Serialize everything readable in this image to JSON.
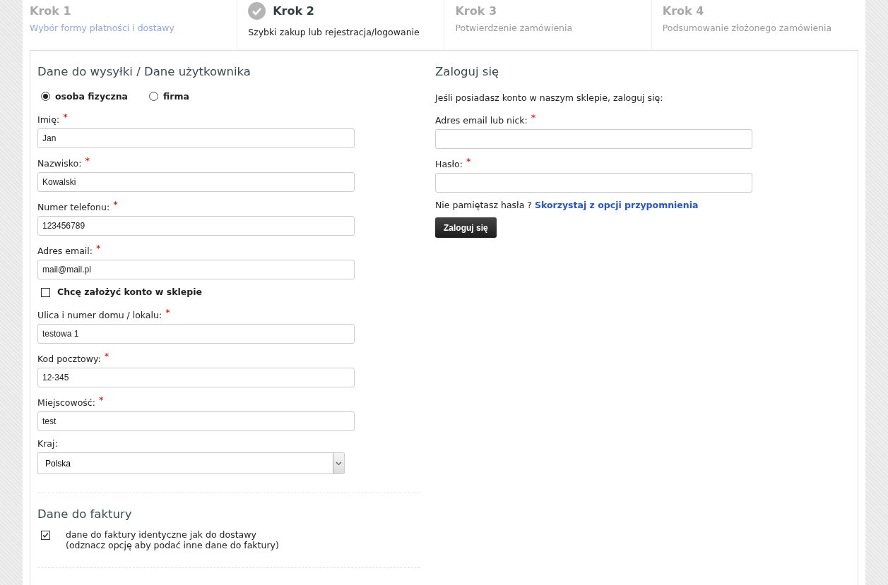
{
  "steps": [
    {
      "title": "Krok 1",
      "subtitle": "Wybór formy płatności i dostawy",
      "done": true,
      "selected": false
    },
    {
      "title": "Krok 2",
      "subtitle": "Szybki zakup lub rejestracja/logowanie",
      "done": false,
      "selected": true
    },
    {
      "title": "Krok 3",
      "subtitle": "Potwierdzenie zamówienia",
      "done": false,
      "selected": false
    },
    {
      "title": "Krok 4",
      "subtitle": "Podsumowanie złożonego zamówienia",
      "done": false,
      "selected": false
    }
  ],
  "shipping": {
    "heading": "Dane do wysyłki / Dane użytkownika",
    "customer_type": [
      {
        "label": "osoba fizyczna",
        "selected": true
      },
      {
        "label": "firma",
        "selected": false
      }
    ],
    "fields": [
      {
        "kind": "text",
        "label": "Imię:",
        "marker": "*",
        "value": "Jan"
      },
      {
        "kind": "text",
        "label": "Nazwisko:",
        "marker": "*",
        "value": "Kowalski"
      },
      {
        "kind": "text",
        "label": "Numer telefonu:",
        "marker": "*",
        "value": "123456789"
      },
      {
        "kind": "text",
        "label": "Adres email:",
        "marker": "*",
        "value": "mail@mail.pl"
      },
      {
        "kind": "checkbox",
        "label": "Chcę założyć konto w sklepie",
        "checked": false
      },
      {
        "kind": "text",
        "label": "Ulica i numer domu / lokalu:",
        "marker": "*",
        "value": "testowa 1"
      },
      {
        "kind": "text",
        "label": "Kod pocztowy:",
        "marker": "*",
        "value": "12-345"
      },
      {
        "kind": "text",
        "label": "Miejscowość:",
        "marker": "*",
        "value": "test"
      },
      {
        "kind": "select",
        "label": "Kraj:",
        "value": "Polska"
      }
    ]
  },
  "invoice": {
    "heading": "Dane do faktury",
    "checked": true,
    "label": "dane do faktury identyczne jak do dostawy",
    "hint": "(odznacz opcję aby podać inne dane do faktury)"
  },
  "login": {
    "heading": "Zaloguj się",
    "intro": "Jeśli posiadasz konto w naszym sklepie, zaloguj się:",
    "fields": [
      {
        "label": "Adres email lub nick:",
        "marker": "*"
      },
      {
        "label": "Hasło:",
        "marker": "*"
      }
    ],
    "forgot": "Nie pamiętasz hasła ?",
    "forgot_link": "Skorzystaj z opcji przypomnienia",
    "button": "Zaloguj się"
  }
}
